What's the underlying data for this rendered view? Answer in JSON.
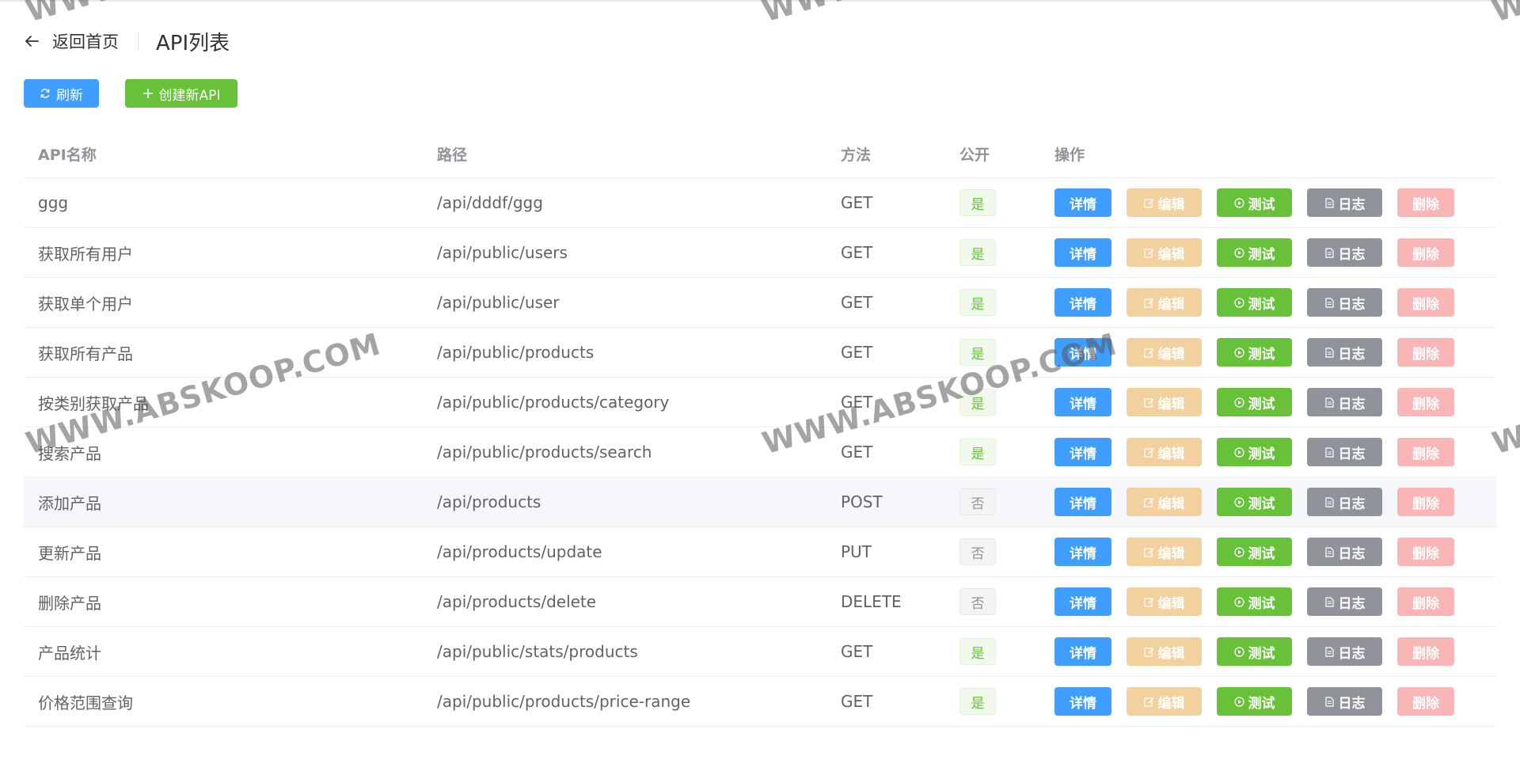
{
  "header": {
    "back_label": "返回首页",
    "title": "API列表"
  },
  "toolbar": {
    "refresh_label": "刷新",
    "create_label": "创建新API"
  },
  "table": {
    "columns": [
      "API名称",
      "路径",
      "方法",
      "公开",
      "操作"
    ],
    "action_labels": {
      "detail": "详情",
      "edit": "编辑",
      "test": "测试",
      "log": "日志",
      "delete": "删除"
    },
    "rows": [
      {
        "name": "ggg",
        "path": "/api/dddf/ggg",
        "method": "GET",
        "public": "是"
      },
      {
        "name": "获取所有用户",
        "path": "/api/public/users",
        "method": "GET",
        "public": "是"
      },
      {
        "name": "获取单个用户",
        "path": "/api/public/user",
        "method": "GET",
        "public": "是"
      },
      {
        "name": "获取所有产品",
        "path": "/api/public/products",
        "method": "GET",
        "public": "是"
      },
      {
        "name": "按类别获取产品",
        "path": "/api/public/products/category",
        "method": "GET",
        "public": "是"
      },
      {
        "name": "搜索产品",
        "path": "/api/public/products/search",
        "method": "GET",
        "public": "是"
      },
      {
        "name": "添加产品",
        "path": "/api/products",
        "method": "POST",
        "public": "否"
      },
      {
        "name": "更新产品",
        "path": "/api/products/update",
        "method": "PUT",
        "public": "否"
      },
      {
        "name": "删除产品",
        "path": "/api/products/delete",
        "method": "DELETE",
        "public": "否"
      },
      {
        "name": "产品统计",
        "path": "/api/public/stats/products",
        "method": "GET",
        "public": "是"
      },
      {
        "name": "价格范围查询",
        "path": "/api/public/products/price-range",
        "method": "GET",
        "public": "是"
      }
    ]
  },
  "watermark": {
    "text": "WWW.ABSKOOP.COM"
  },
  "colors": {
    "primary": "#409eff",
    "success": "#67c23a",
    "warning_light": "#f3d19e",
    "info": "#909399",
    "danger_light": "#fab6b6"
  },
  "icons": {
    "back": "arrow-left-icon",
    "refresh": "refresh-icon",
    "create": "plus-icon",
    "edit": "edit-icon",
    "test": "play-circle-icon",
    "log": "document-icon"
  }
}
